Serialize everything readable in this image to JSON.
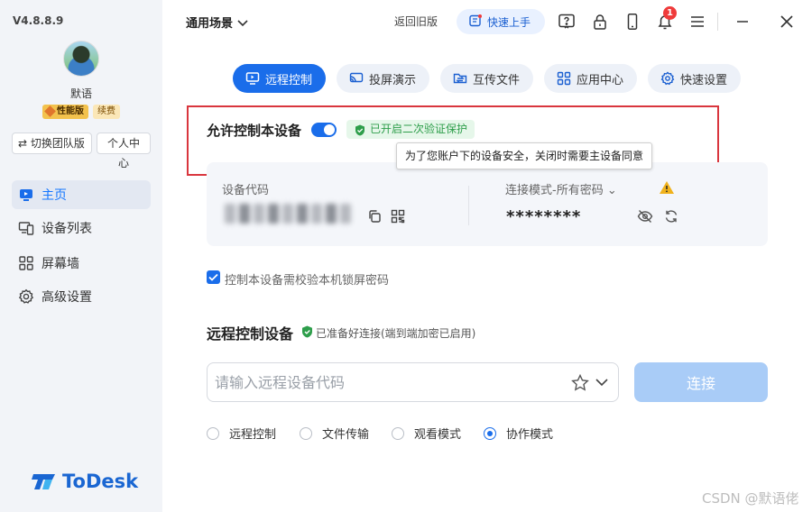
{
  "app": {
    "version": "V4.8.8.9"
  },
  "user": {
    "name": "默语",
    "vip_badge": "性能版",
    "renew_badge": "续费"
  },
  "sidebar": {
    "switch_team": "⇄ 切换团队版",
    "personal_center": "个人中心",
    "items": [
      {
        "label": "主页",
        "icon": "home-icon",
        "active": true
      },
      {
        "label": "设备列表",
        "icon": "devices-icon",
        "active": false
      },
      {
        "label": "屏幕墙",
        "icon": "grid-icon",
        "active": false
      },
      {
        "label": "高级设置",
        "icon": "gear-icon",
        "active": false
      }
    ],
    "brand": "ToDesk"
  },
  "topbar": {
    "scene": "通用场景",
    "old_version": "返回旧版",
    "quick_start": "快速上手",
    "notification_count": "1"
  },
  "tabs": [
    {
      "label": "远程控制",
      "active": true
    },
    {
      "label": "投屏演示",
      "active": false
    },
    {
      "label": "互传文件",
      "active": false
    },
    {
      "label": "应用中心",
      "active": false
    },
    {
      "label": "快速设置",
      "active": false
    }
  ],
  "allow": {
    "label": "允许控制本设备",
    "enabled": true,
    "twofa_badge": "已开启二次验证保护",
    "tooltip": "为了您账户下的设备安全，关闭时需要主设备同意"
  },
  "device": {
    "code_label": "设备代码",
    "mode_label": "连接模式-所有密码 ⌄",
    "password": "********"
  },
  "lock_check": {
    "label": "控制本设备需校验本机锁屏密码",
    "checked": true
  },
  "remote": {
    "title": "远程控制设备",
    "status": "已准备好连接(端到端加密已启用)",
    "input_placeholder": "请输入远程设备代码",
    "connect_label": "连接",
    "modes": [
      {
        "label": "远程控制",
        "selected": false
      },
      {
        "label": "文件传输",
        "selected": false
      },
      {
        "label": "观看模式",
        "selected": false
      },
      {
        "label": "协作模式",
        "selected": true
      }
    ]
  },
  "colors": {
    "accent": "#1a6dea",
    "highlight_box": "#d9363e",
    "success": "#2e9e4b",
    "connect_disabled": "#a9ccf7"
  },
  "watermark": "CSDN @默语佬"
}
